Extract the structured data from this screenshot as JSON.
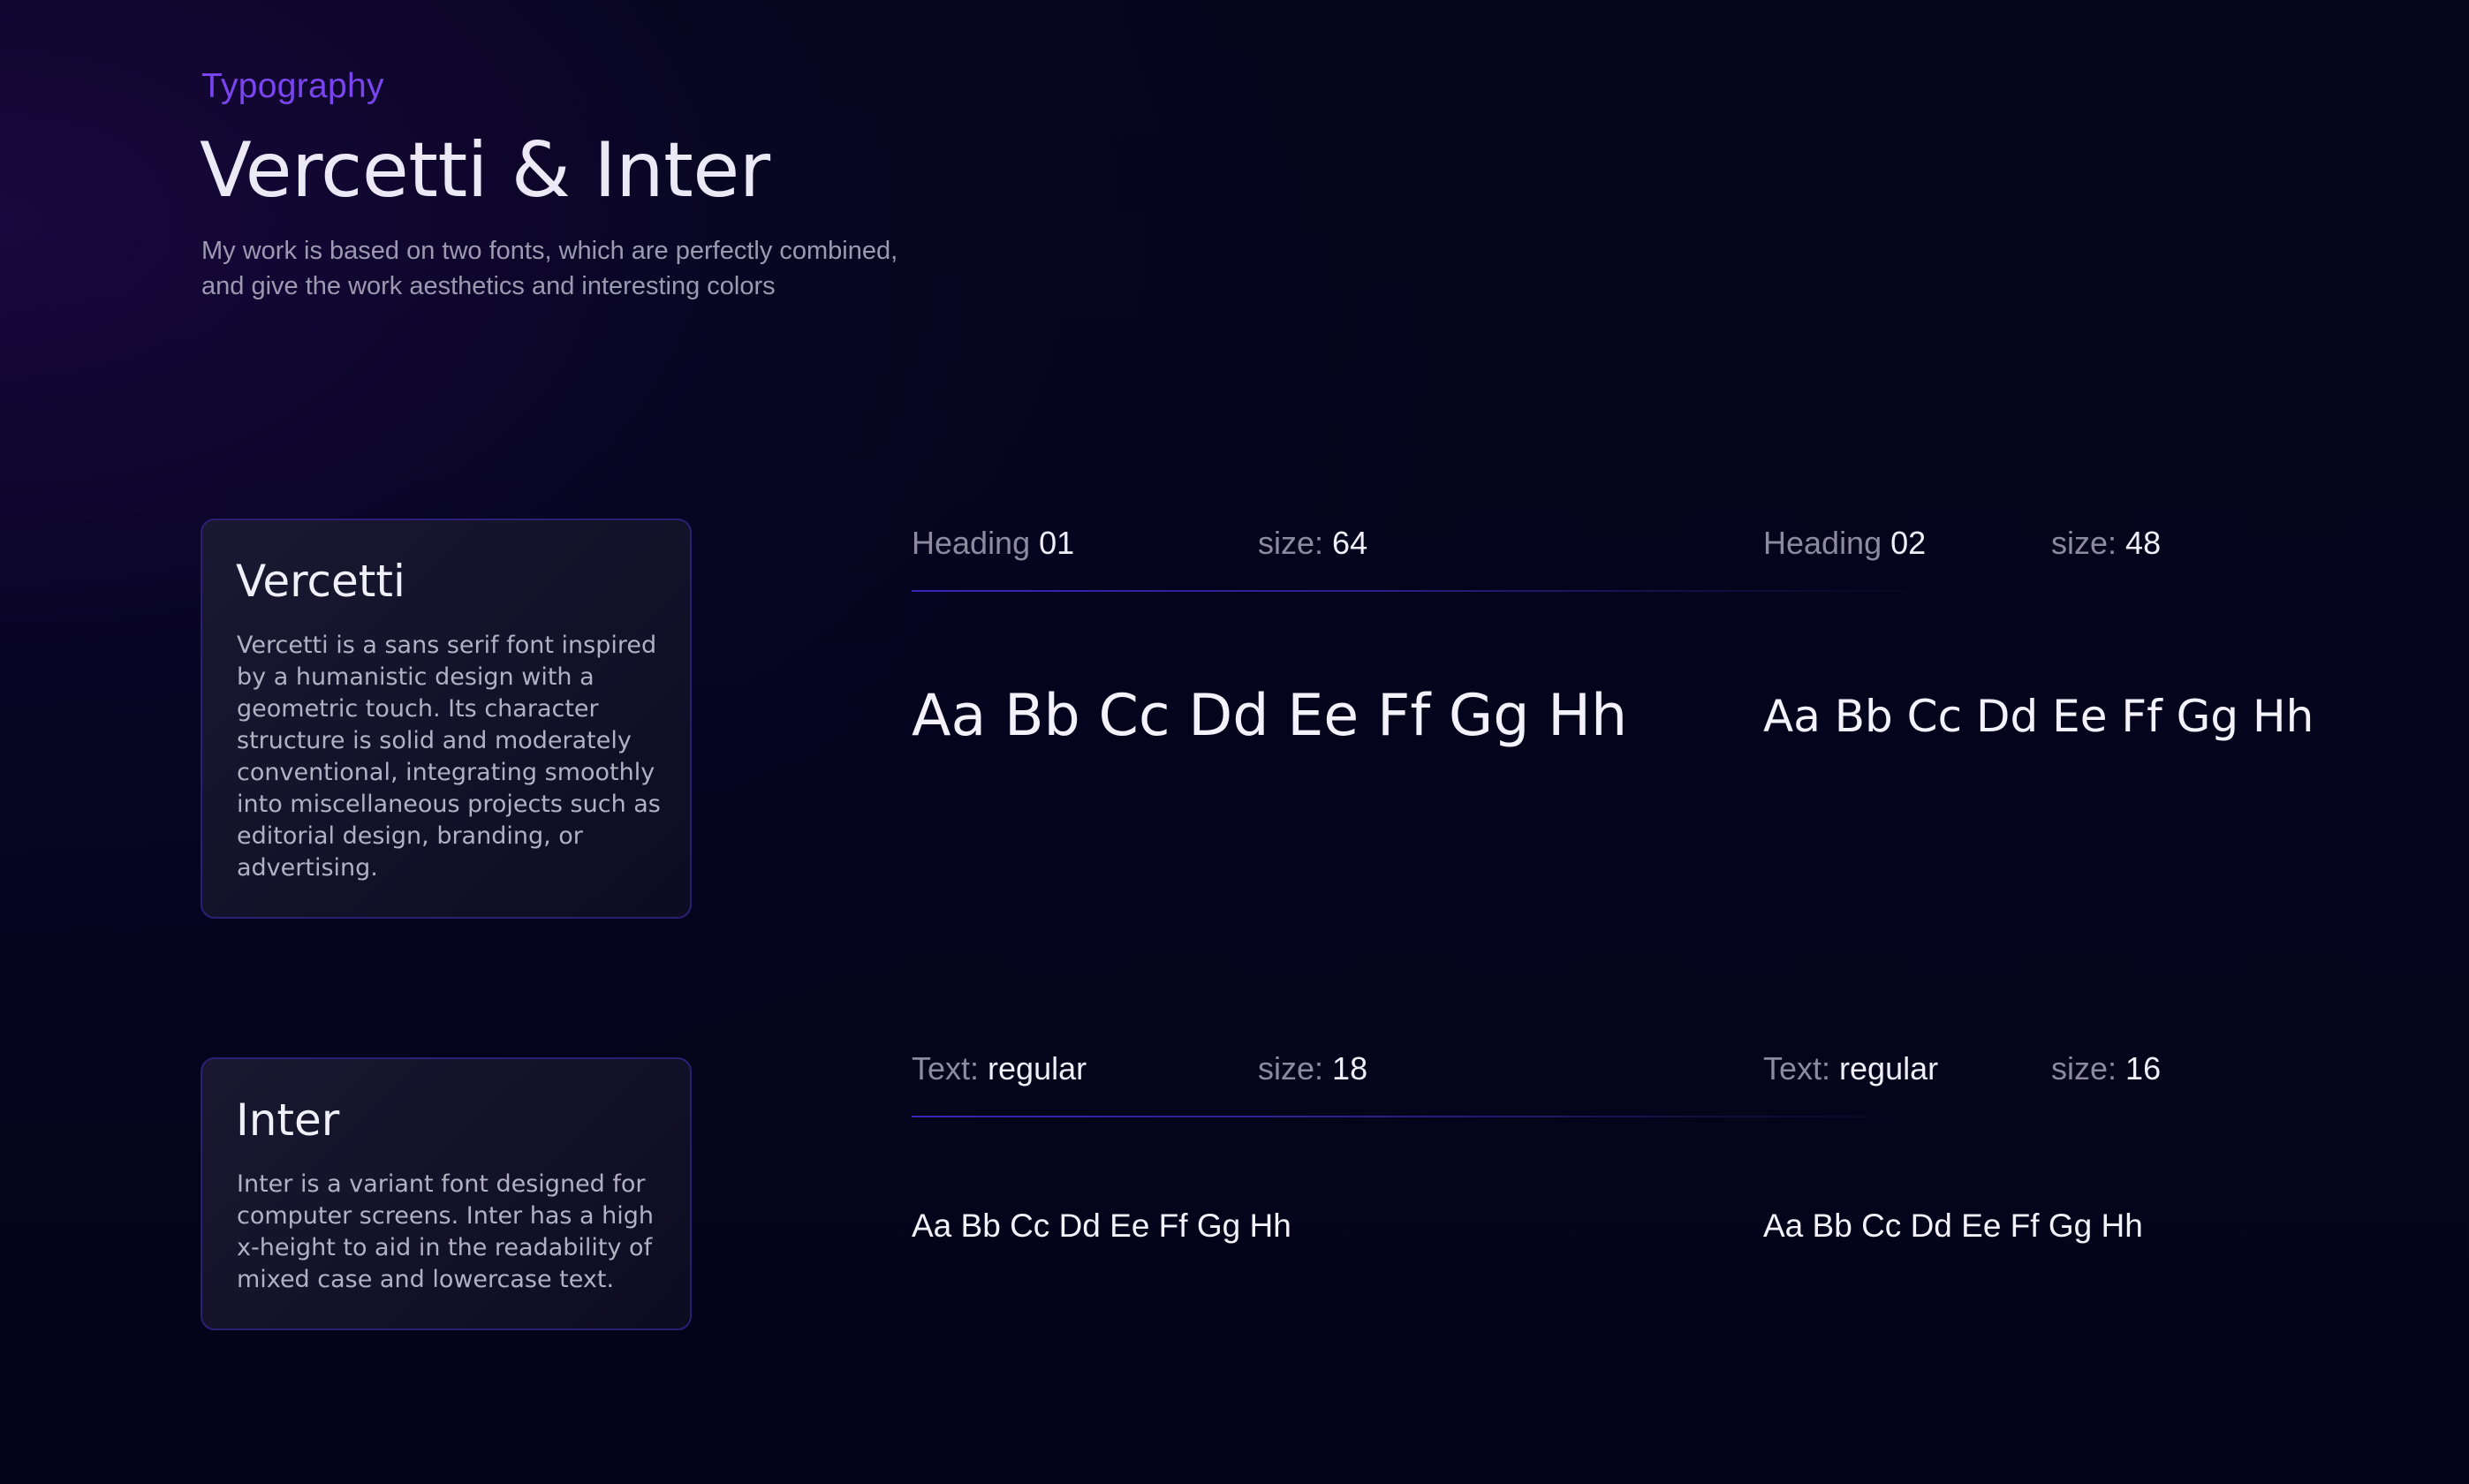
{
  "header": {
    "eyebrow": "Typography",
    "title": "Vercetti & Inter",
    "subtitle_lines": [
      "My work is based on two fonts, which are perfectly combined,",
      "and give the work aesthetics and interesting colors"
    ]
  },
  "fonts": [
    {
      "name": "Vercetti",
      "description_lines": [
        "Vercetti is a sans serif font inspired",
        "by a humanistic design with a",
        "geometric touch. Its character",
        "structure is solid and moderately",
        "conventional, integrating smoothly",
        "into miscellaneous projects such as",
        "editorial design, branding, or",
        "advertising."
      ]
    },
    {
      "name": "Inter",
      "description_lines": [
        "Inter is a variant font designed for",
        "computer screens. Inter has a high",
        "x-height to aid in the readability of",
        "mixed case and lowercase text."
      ]
    }
  ],
  "specimens": [
    {
      "label_key": "Heading",
      "label_value": "01",
      "size_key": "size:",
      "size_value": "64",
      "sample": "Aa Bb Cc Dd Ee Ff Gg Hh"
    },
    {
      "label_key": "Heading",
      "label_value": "02",
      "size_key": "size:",
      "size_value": "48",
      "sample": "Aa Bb Cc Dd Ee Ff Gg Hh"
    },
    {
      "label_key": "Text:",
      "label_value": "regular",
      "size_key": "size:",
      "size_value": "18",
      "sample": "Aa Bb Cc Dd Ee Ff Gg Hh"
    },
    {
      "label_key": "Text:",
      "label_value": "regular",
      "size_key": "size:",
      "size_value": "16",
      "sample": "Aa Bb Cc Dd Ee Ff Gg Hh"
    }
  ],
  "colors": {
    "accent": "#7a45ee",
    "card_border": "#2b1f73",
    "rule": "#3b24b8",
    "background": "#05051a"
  }
}
